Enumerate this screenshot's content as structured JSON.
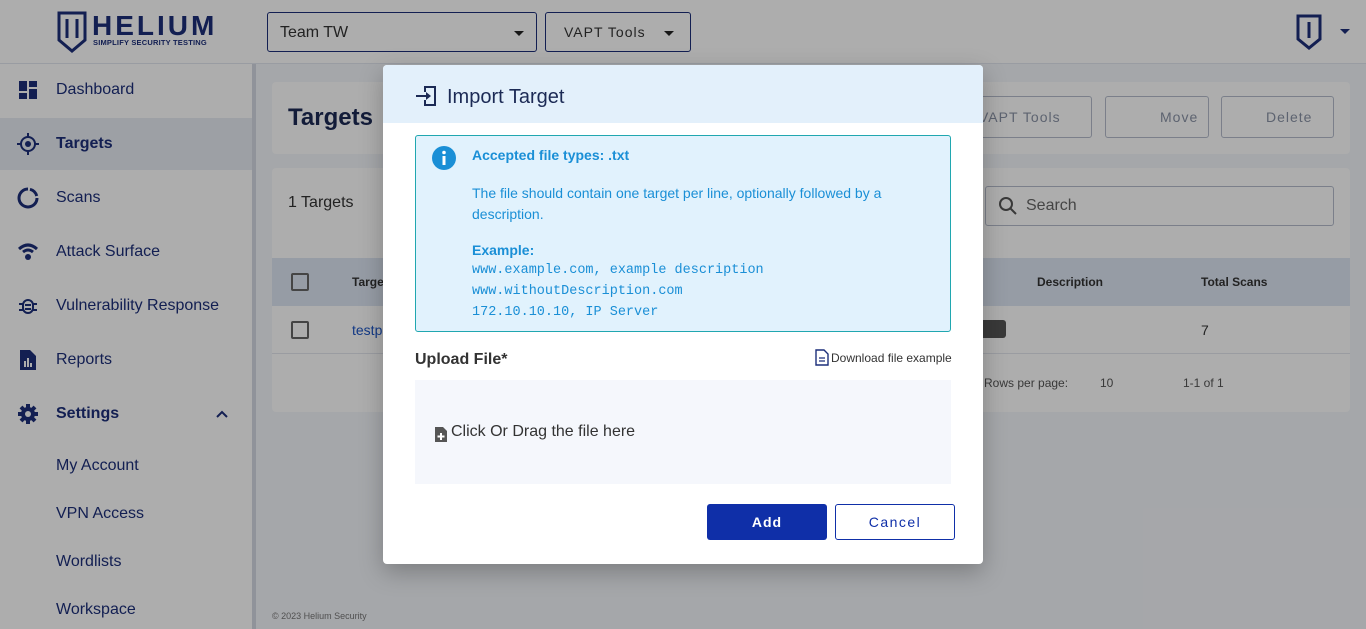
{
  "header": {
    "logo_word": "HELIUM",
    "logo_tagline": "SIMPLIFY SECURITY TESTING",
    "team_select": "Team TW",
    "tools_select": "VAPT Tools"
  },
  "sidebar": {
    "items": [
      {
        "label": "Dashboard",
        "icon": "dashboard-icon"
      },
      {
        "label": "Targets",
        "icon": "target-icon"
      },
      {
        "label": "Scans",
        "icon": "scans-icon"
      },
      {
        "label": "Attack Surface",
        "icon": "attack-surface-icon"
      },
      {
        "label": "Vulnerability Response",
        "icon": "bug-icon"
      },
      {
        "label": "Reports",
        "icon": "reports-icon"
      },
      {
        "label": "Settings",
        "icon": "gear-icon"
      }
    ],
    "settings_children": [
      "My Account",
      "VPN Access",
      "Wordlists",
      "Workspace"
    ]
  },
  "main": {
    "title": "Targets",
    "toolbar": {
      "tools_label": "VAPT Tools",
      "move_label": "Move",
      "delete_label": "Delete"
    },
    "count_label": "1 Targets",
    "search_placeholder": "Search",
    "columns": [
      "Target",
      "Description",
      "Total Scans"
    ],
    "rows": [
      {
        "target": "testp",
        "total_scans": "7"
      }
    ],
    "pagination": {
      "rows_per_page_label": "Rows per page:",
      "rows_per_page": "10",
      "range": "1-1 of 1"
    }
  },
  "footer": "© 2023 Helium Security",
  "dialog": {
    "title": "Import Target",
    "info_heading": "Accepted file types: .txt",
    "info_text": "The file should contain one target per line, optionally followed by a description.",
    "example_heading": "Example:",
    "example_lines": [
      "www.example.com, example description",
      "www.withoutDescription.com",
      "172.10.10.10, IP Server"
    ],
    "upload_label": "Upload File*",
    "download_link": "Download file example",
    "dropzone_text": "Click Or Drag the file here",
    "add_label": "Add",
    "cancel_label": "Cancel"
  },
  "colors": {
    "brand": "#1c2f7a",
    "primary_button": "#0f2fa8",
    "info_text": "#1a8fd6",
    "info_bg": "#e1f2fd"
  }
}
